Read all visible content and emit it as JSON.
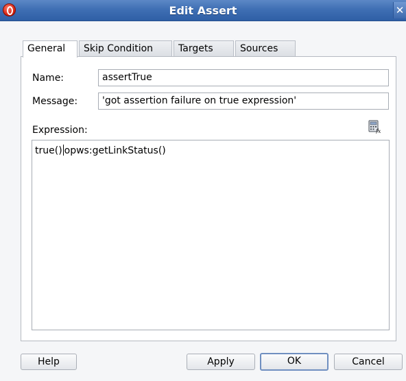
{
  "window": {
    "title": "Edit Assert",
    "close_glyph": "✕"
  },
  "tabs": [
    {
      "label": "General"
    },
    {
      "label": "Skip Condition"
    },
    {
      "label": "Targets"
    },
    {
      "label": "Sources"
    }
  ],
  "form": {
    "name_label": "Name:",
    "name_value": "assertTrue",
    "message_label": "Message:",
    "message_value": "'got assertion failure on true expression'",
    "expression_label": "Expression:",
    "expression_before_caret": "true()",
    "expression_after_caret": "opws:getLinkStatus()"
  },
  "buttons": {
    "help": "Help",
    "apply": "Apply",
    "ok": "OK",
    "cancel": "Cancel"
  },
  "icons": {
    "app": "oracle-app-icon",
    "close": "close-icon",
    "expression_builder": "expression-builder-icon"
  }
}
